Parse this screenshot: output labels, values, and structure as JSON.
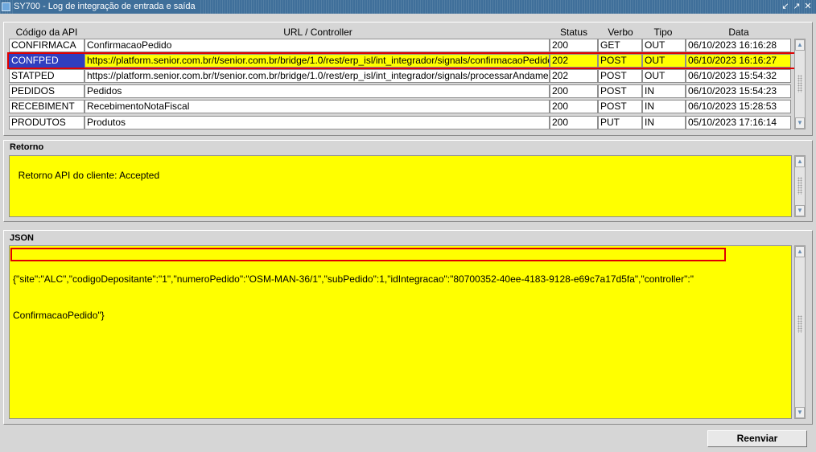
{
  "window": {
    "title": "SY700 - Log de integração de entrada e saída",
    "controls": [
      "↙",
      "↗",
      "✕"
    ]
  },
  "table": {
    "headers": {
      "code": "Código da API",
      "url": "URL / Controller",
      "status": "Status",
      "verb": "Verbo",
      "type": "Tipo",
      "date": "Data"
    },
    "rows": [
      {
        "code": "CONFIRMACA",
        "url": "ConfirmacaoPedido",
        "status": "200",
        "verb": "GET",
        "type": "OUT",
        "date": "06/10/2023 16:16:28"
      },
      {
        "code": "CONFPED",
        "url": "https://platform.senior.com.br/t/senior.com.br/bridge/1.0/rest/erp_isl/int_integrador/signals/confirmacaoPedido",
        "status": "202",
        "verb": "POST",
        "type": "OUT",
        "date": "06/10/2023 16:16:27"
      },
      {
        "code": "STATPED",
        "url": "https://platform.senior.com.br/t/senior.com.br/bridge/1.0/rest/erp_isl/int_integrador/signals/processarAndamento",
        "status": "202",
        "verb": "POST",
        "type": "OUT",
        "date": "06/10/2023 15:54:32"
      },
      {
        "code": "PEDIDOS",
        "url": "Pedidos",
        "status": "200",
        "verb": "POST",
        "type": "IN",
        "date": "06/10/2023 15:54:23"
      },
      {
        "code": "RECEBIMENT",
        "url": "RecebimentoNotaFiscal",
        "status": "200",
        "verb": "POST",
        "type": "IN",
        "date": "06/10/2023 15:28:53"
      },
      {
        "code": "PRODUTOS",
        "url": "Produtos",
        "status": "200",
        "verb": "PUT",
        "type": "IN",
        "date": "05/10/2023 17:16:14"
      }
    ]
  },
  "retorno": {
    "label": "Retorno",
    "text": "Retorno API do cliente: Accepted"
  },
  "json_section": {
    "label": "JSON",
    "line1": "{\"site\":\"ALC\",\"codigoDepositante\":\"1\",\"numeroPedido\":\"OSM-MAN-36/1\",\"subPedido\":1,\"idIntegracao\":\"80700352-40ee-4183-9128-e69c7a17d5fa\",\"controller\":\"",
    "line2": "ConfirmacaoPedido\"}"
  },
  "buttons": {
    "resend": "Reenviar"
  },
  "colors": {
    "selection_bg": "#ffff00",
    "selected_code_bg": "#2f3ec0",
    "highlight_border": "#e00000",
    "titlebar": "#3f6f9a"
  }
}
